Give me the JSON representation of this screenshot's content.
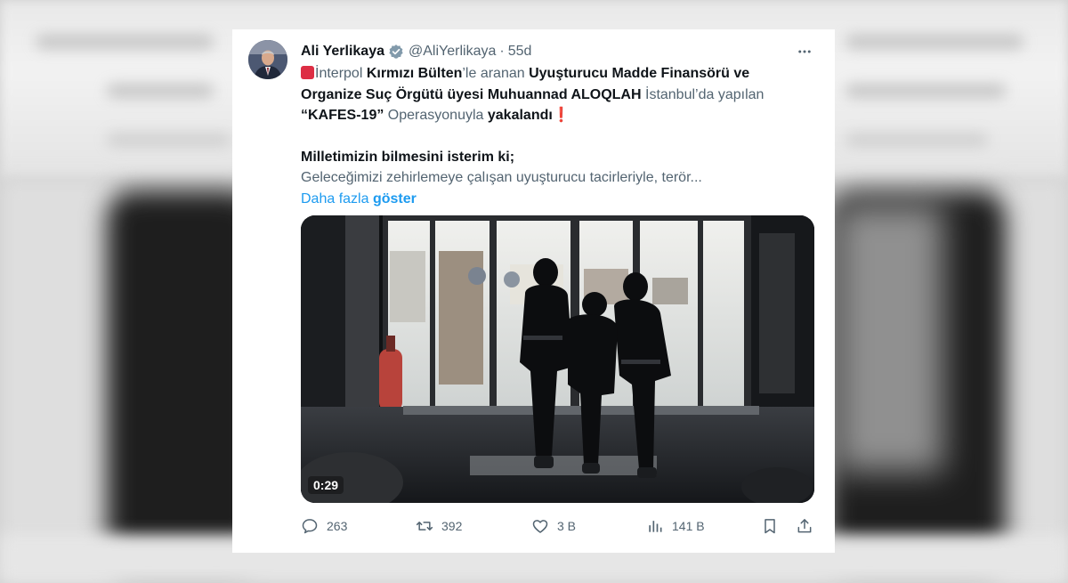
{
  "tweet": {
    "author_name": "Ali Yerlikaya",
    "handle": "@AliYerlikaya",
    "separator": "·",
    "age": "55d",
    "more_icon": "more-horizontal-icon",
    "verified_icon": "verified-badge-icon",
    "text": {
      "l1_a": "İnterpol ",
      "l1_b": "Kırmızı Bülten",
      "l1_c": "’le aranan ",
      "l1_d": "Uyuşturucu Madde Finansörü ve",
      "l2_a": "Organize Suç Örgütü üyesi Muhuannad ALOQLAH",
      "l2_b": " İstanbul’da yapılan",
      "l3_a": "“KAFES-19”",
      "l3_b": " Operasyonuyla ",
      "l3_c": "yakalandı",
      "l3_excl": "❗",
      "l4": "Milletimizin bilmesini isterim ki;",
      "l5": "Geleceğimizi zehirlemeye çalışan uyuşturucu tacirleriyle, terör..."
    },
    "show_more_a": "Daha fazla ",
    "show_more_b": "göster",
    "video_duration": "0:29",
    "stats": {
      "replies": "263",
      "retweets": "392",
      "likes": "3 B",
      "views": "141 B"
    }
  },
  "colors": {
    "accent": "#1d9bf0",
    "muted": "#536471",
    "text": "#0f1419",
    "red": "#dd2e44"
  }
}
